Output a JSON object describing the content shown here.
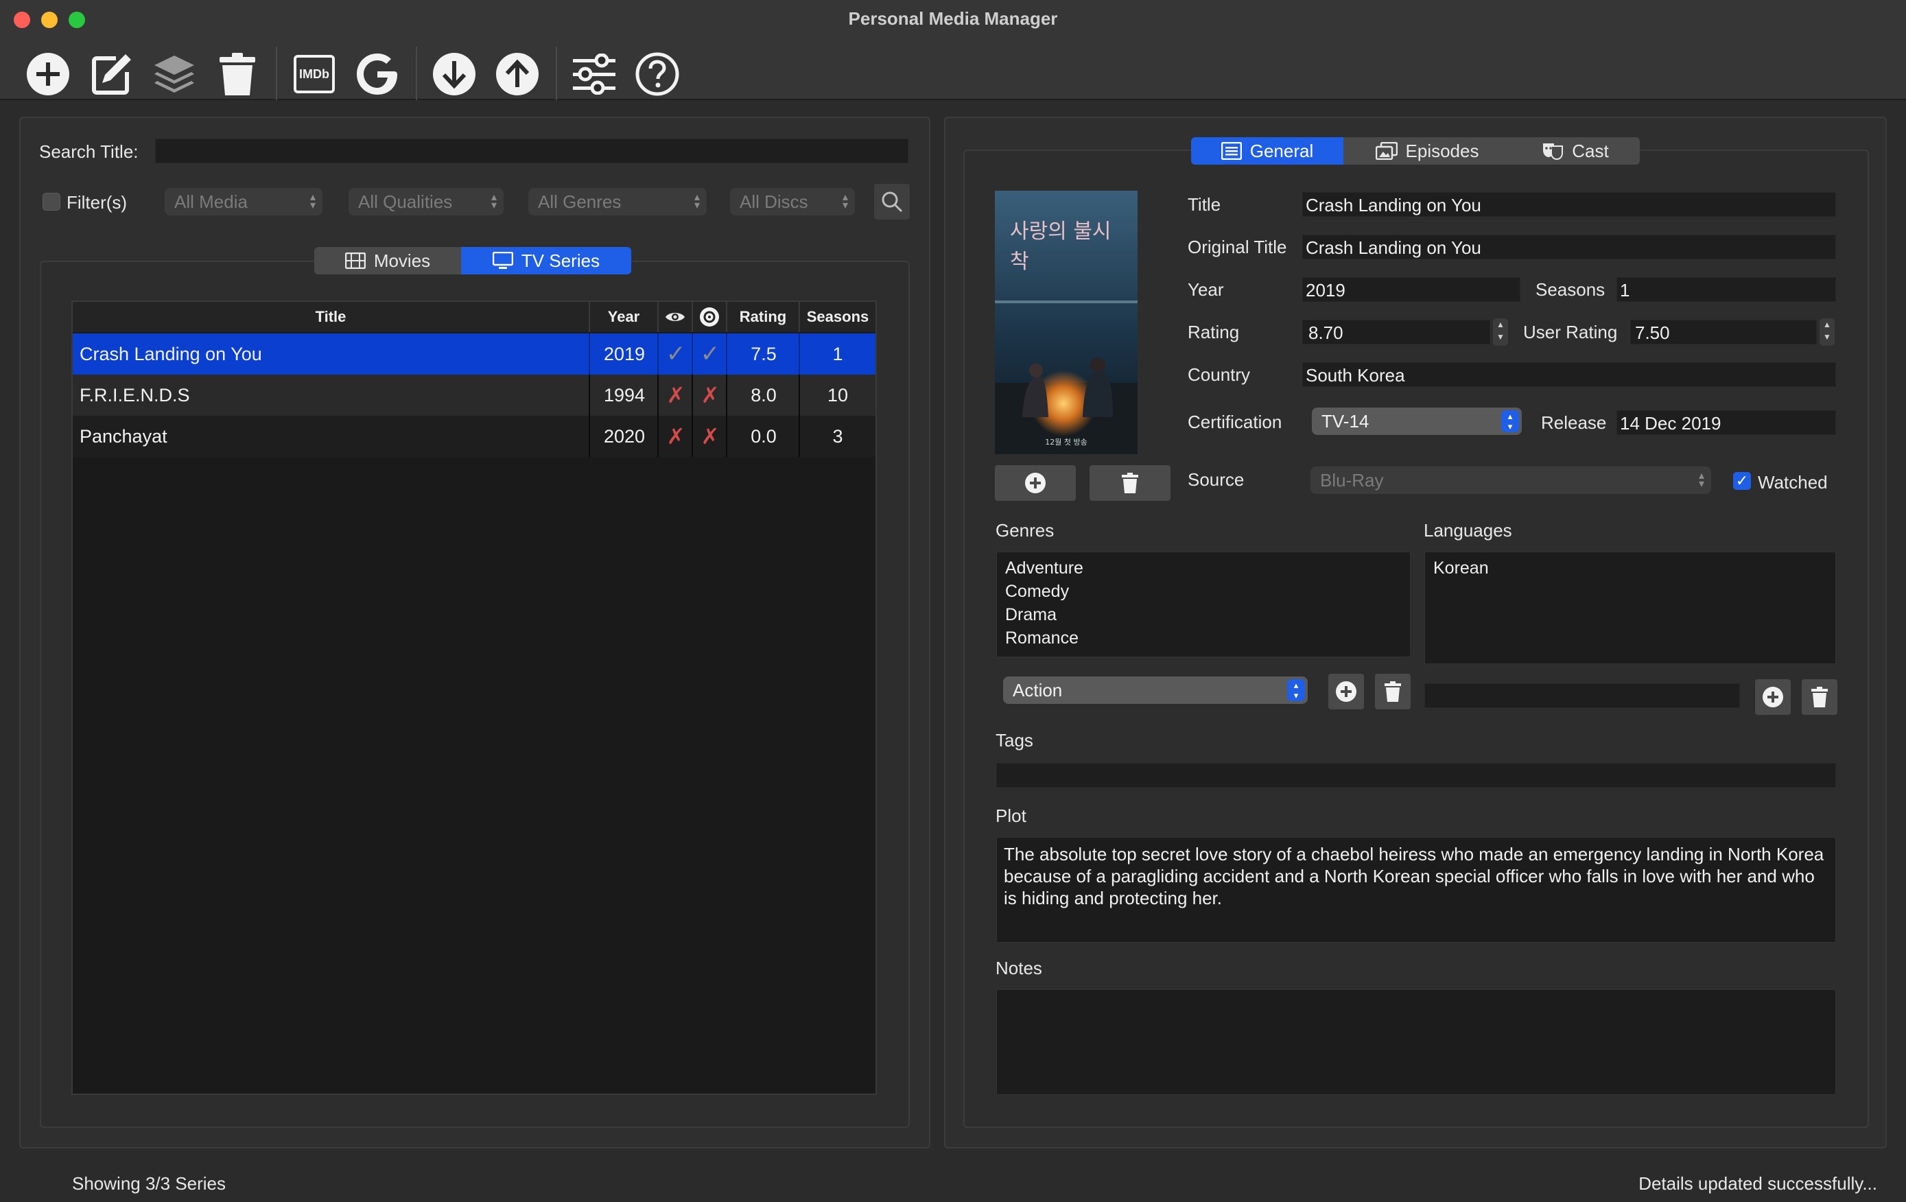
{
  "window": {
    "title": "Personal Media Manager"
  },
  "toolbar": {
    "buttons": [
      {
        "name": "add",
        "icon": "plus-circle-icon"
      },
      {
        "name": "edit",
        "icon": "edit-icon"
      },
      {
        "name": "layers",
        "icon": "layers-icon"
      },
      {
        "name": "delete",
        "icon": "trash-icon"
      },
      {
        "name": "imdb",
        "icon": "imdb-icon",
        "label": "IMDb"
      },
      {
        "name": "google",
        "icon": "google-icon",
        "label": "G"
      },
      {
        "name": "download",
        "icon": "arrow-down-circle-icon"
      },
      {
        "name": "upload",
        "icon": "arrow-up-circle-icon"
      },
      {
        "name": "settings",
        "icon": "sliders-icon"
      },
      {
        "name": "help",
        "icon": "help-circle-icon"
      }
    ]
  },
  "left": {
    "search_label": "Search Title:",
    "search_value": "",
    "filter_label": "Filter(s)",
    "filters": [
      "All Media",
      "All Qualities",
      "All Genres",
      "All Discs"
    ],
    "tabs": [
      {
        "label": "Movies",
        "icon": "film-icon",
        "active": false
      },
      {
        "label": "TV Series",
        "icon": "tv-icon",
        "active": true
      }
    ],
    "table": {
      "headers": [
        "Title",
        "Year",
        "",
        "",
        "Rating",
        "Seasons"
      ],
      "rows": [
        {
          "title": "Crash Landing on You",
          "year": "2019",
          "watched": "✓",
          "disc": "✓",
          "rating": "7.5",
          "seasons": "1",
          "selected": true
        },
        {
          "title": "F.R.I.E.N.D.S",
          "year": "1994",
          "watched": "✗",
          "disc": "✗",
          "rating": "8.0",
          "seasons": "10",
          "selected": false
        },
        {
          "title": "Panchayat",
          "year": "2020",
          "watched": "✗",
          "disc": "✗",
          "rating": "0.0",
          "seasons": "3",
          "selected": false
        }
      ]
    }
  },
  "right": {
    "tabs": [
      {
        "label": "General",
        "icon": "list-icon",
        "active": true
      },
      {
        "label": "Episodes",
        "icon": "episodes-icon",
        "active": false
      },
      {
        "label": "Cast",
        "icon": "theater-masks-icon",
        "active": false
      }
    ],
    "poster": {
      "text": "사랑의 불시착",
      "caption": "12월 첫 방송"
    },
    "fields": {
      "title_label": "Title",
      "title": "Crash Landing on You",
      "original_title_label": "Original Title",
      "original_title": "Crash Landing on You",
      "year_label": "Year",
      "year": "2019",
      "seasons_label": "Seasons",
      "seasons": "1",
      "rating_label": "Rating",
      "rating": "8.70",
      "user_rating_label": "User Rating",
      "user_rating": "7.50",
      "country_label": "Country",
      "country": "South Korea",
      "certification_label": "Certification",
      "certification": "TV-14",
      "release_label": "Release",
      "release": "14 Dec 2019",
      "source_label": "Source",
      "source": "Blu-Ray",
      "watched_label": "Watched"
    },
    "genres_label": "Genres",
    "genres": [
      "Adventure",
      "Comedy",
      "Drama",
      "Romance"
    ],
    "genre_select": "Action",
    "languages_label": "Languages",
    "languages": [
      "Korean"
    ],
    "tags_label": "Tags",
    "plot_label": "Plot",
    "plot": "The absolute top secret love story of a chaebol heiress who made an emergency landing in North Korea because of a paragliding accident and a North Korean special officer who falls in love with her and who is hiding and protecting her.",
    "notes_label": "Notes",
    "notes": ""
  },
  "status": {
    "left": "Showing 3/3 Series",
    "right": "Details updated successfully..."
  },
  "colors": {
    "accent": "#1f5ee6",
    "selection": "#0a3fd0",
    "check": "#8a8a8a",
    "cross": "#d24a4a",
    "traffic_red": "#ff5f57",
    "traffic_yellow": "#febc2e",
    "traffic_green": "#28c840"
  }
}
